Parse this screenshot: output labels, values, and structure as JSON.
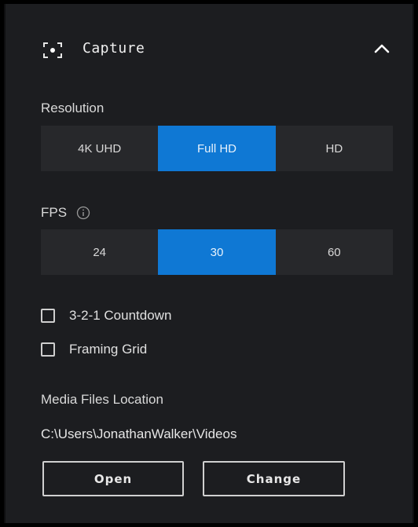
{
  "header": {
    "title": "Capture",
    "icon": "capture-icon",
    "toggle_icon": "chevron-up-icon"
  },
  "resolution": {
    "label": "Resolution",
    "options": [
      "4K UHD",
      "Full HD",
      "HD"
    ],
    "selected": "Full HD"
  },
  "fps": {
    "label": "FPS",
    "info_icon": "info-icon",
    "options": [
      "24",
      "30",
      "60"
    ],
    "selected": "30"
  },
  "options": {
    "countdown": {
      "label": "3-2-1 Countdown",
      "checked": false
    },
    "framing_grid": {
      "label": "Framing Grid",
      "checked": false
    }
  },
  "media": {
    "label": "Media Files Location",
    "path": "C:\\Users\\JonathanWalker\\Videos",
    "open_label": "Open",
    "change_label": "Change"
  },
  "colors": {
    "panel_bg": "#1c1d20",
    "segment_bg": "#27282b",
    "accent": "#0f78d4",
    "text": "#e6e6e6"
  }
}
